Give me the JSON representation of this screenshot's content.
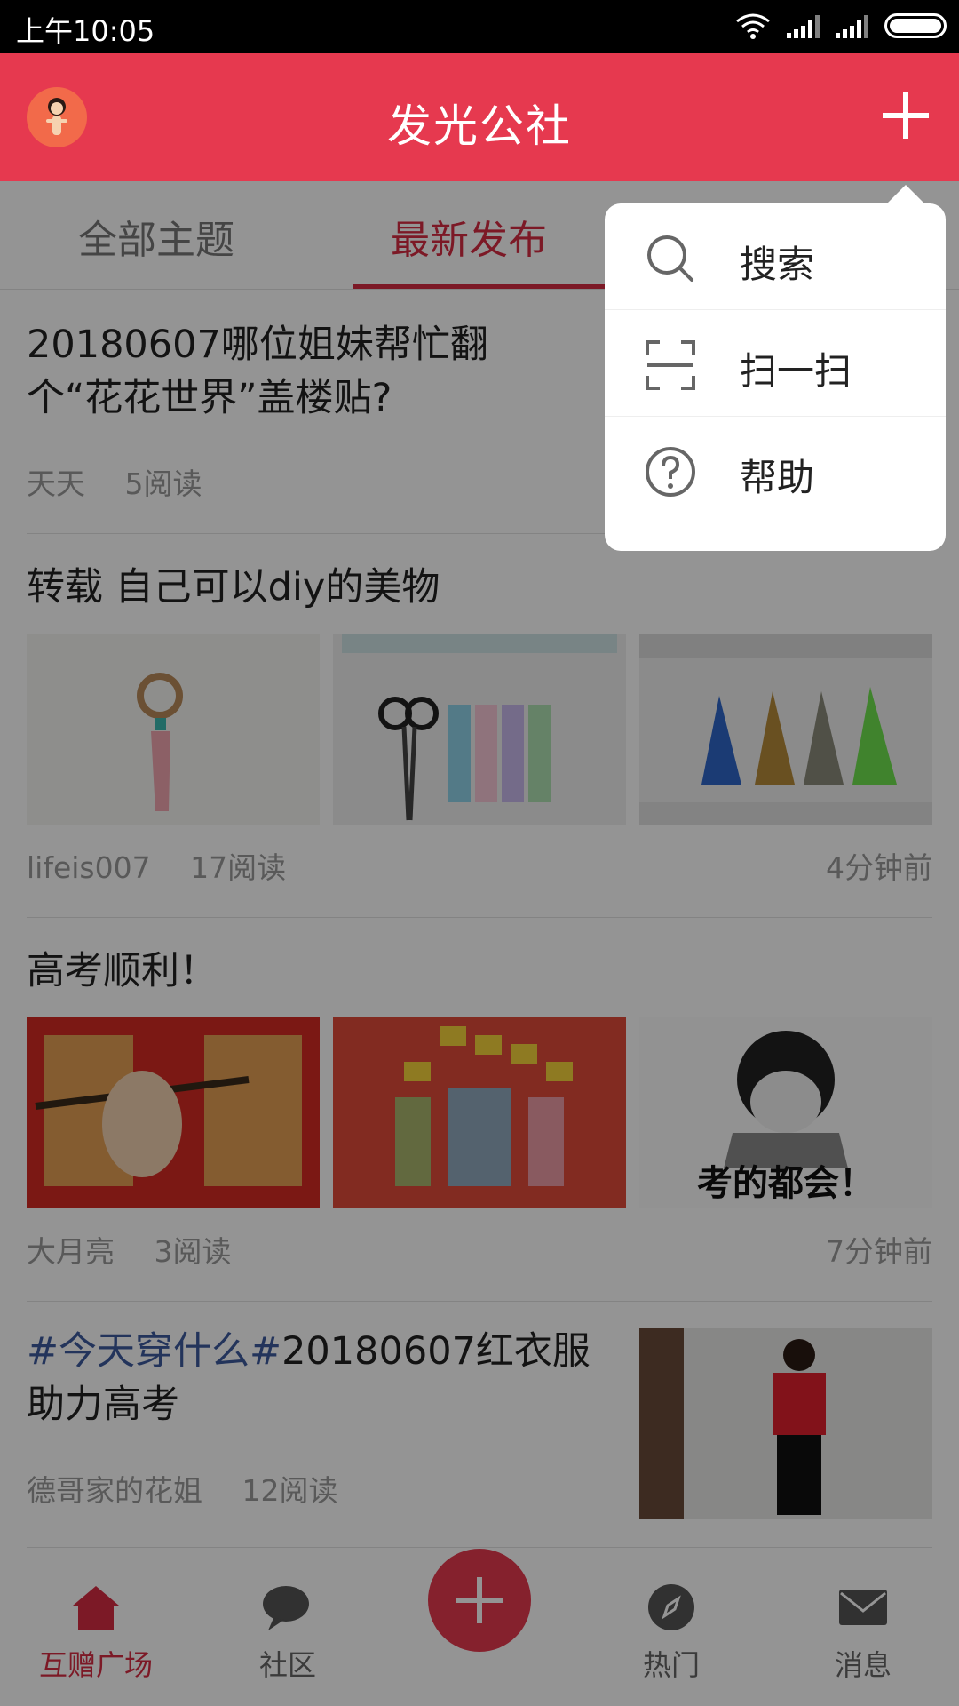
{
  "status_bar": {
    "time": "上午10:05"
  },
  "app_bar": {
    "title": "发光公社",
    "left_icon": "avatar",
    "right_icon": "plus-icon"
  },
  "tabs": [
    {
      "label": "全部主题",
      "active": false
    },
    {
      "label": "最新发布",
      "active": true
    }
  ],
  "posts": [
    {
      "title": "20180607哪位姐妹帮忙翻个“花花世界”盖楼贴?",
      "author": "天天",
      "reads": "5阅读",
      "time": ""
    },
    {
      "title": "转载 自己可以diy的美物",
      "author": "lifeis007",
      "reads": "17阅读",
      "time": "4分钟前"
    },
    {
      "title": "高考顺利！",
      "author": "大月亮",
      "reads": "3阅读",
      "time": "7分钟前",
      "image_text": "考的都会！"
    },
    {
      "hashtag": "#今天穿什么#",
      "title": "20180607红衣服助力高考",
      "author": "德哥家的花姐",
      "reads": "12阅读"
    }
  ],
  "popup_menu": {
    "items": [
      {
        "label": "搜索",
        "icon": "search-icon"
      },
      {
        "label": "扫一扫",
        "icon": "scan-icon"
      },
      {
        "label": "帮助",
        "icon": "help-icon"
      }
    ]
  },
  "bottom_nav": {
    "items": [
      {
        "label": "互赠广场",
        "icon": "home-icon",
        "active": true
      },
      {
        "label": "社区",
        "icon": "chat-bubble-icon",
        "active": false
      },
      {
        "label": "",
        "icon": "plus-icon",
        "active": false
      },
      {
        "label": "热门",
        "icon": "compass-icon",
        "active": false
      },
      {
        "label": "消息",
        "icon": "envelope-icon",
        "active": false
      }
    ]
  },
  "colors": {
    "brand": "#e6394f",
    "active_text": "#d62b43",
    "hashtag": "#3d5a9e"
  }
}
